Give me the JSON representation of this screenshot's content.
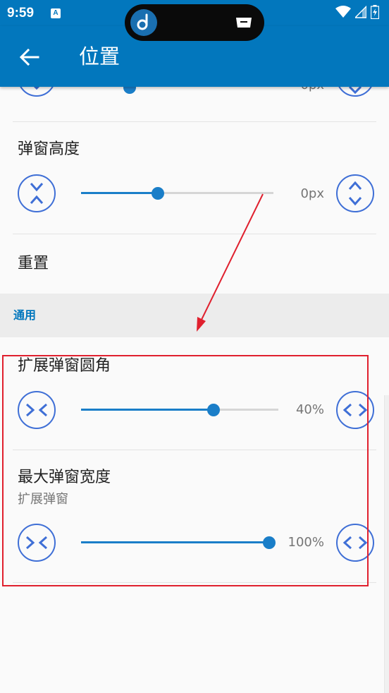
{
  "status_bar": {
    "time": "9:59",
    "notification_icon_letter": "A",
    "colors": {
      "background": "#0277bd"
    }
  },
  "app_bar": {
    "title": "位置",
    "back_icon": "arrow-left-icon"
  },
  "prefs": {
    "top_partial": {
      "value": "0px"
    },
    "popup_height": {
      "title": "弹窗高度",
      "value": "0px",
      "progress": 0.4
    },
    "reset": {
      "title": "重置"
    },
    "section_general": {
      "title": "通用"
    },
    "corner_radius": {
      "title": "扩展弹窗圆角",
      "value": "40%",
      "progress": 0.67
    },
    "max_width": {
      "title": "最大弹窗宽度",
      "summary": "扩展弹窗",
      "value": "100%",
      "progress": 1.0
    }
  },
  "colors": {
    "accent": "#0277bd",
    "slider": "#1a7ec8",
    "button_outline": "#3f6fd6",
    "annotation": "#e0202e"
  }
}
